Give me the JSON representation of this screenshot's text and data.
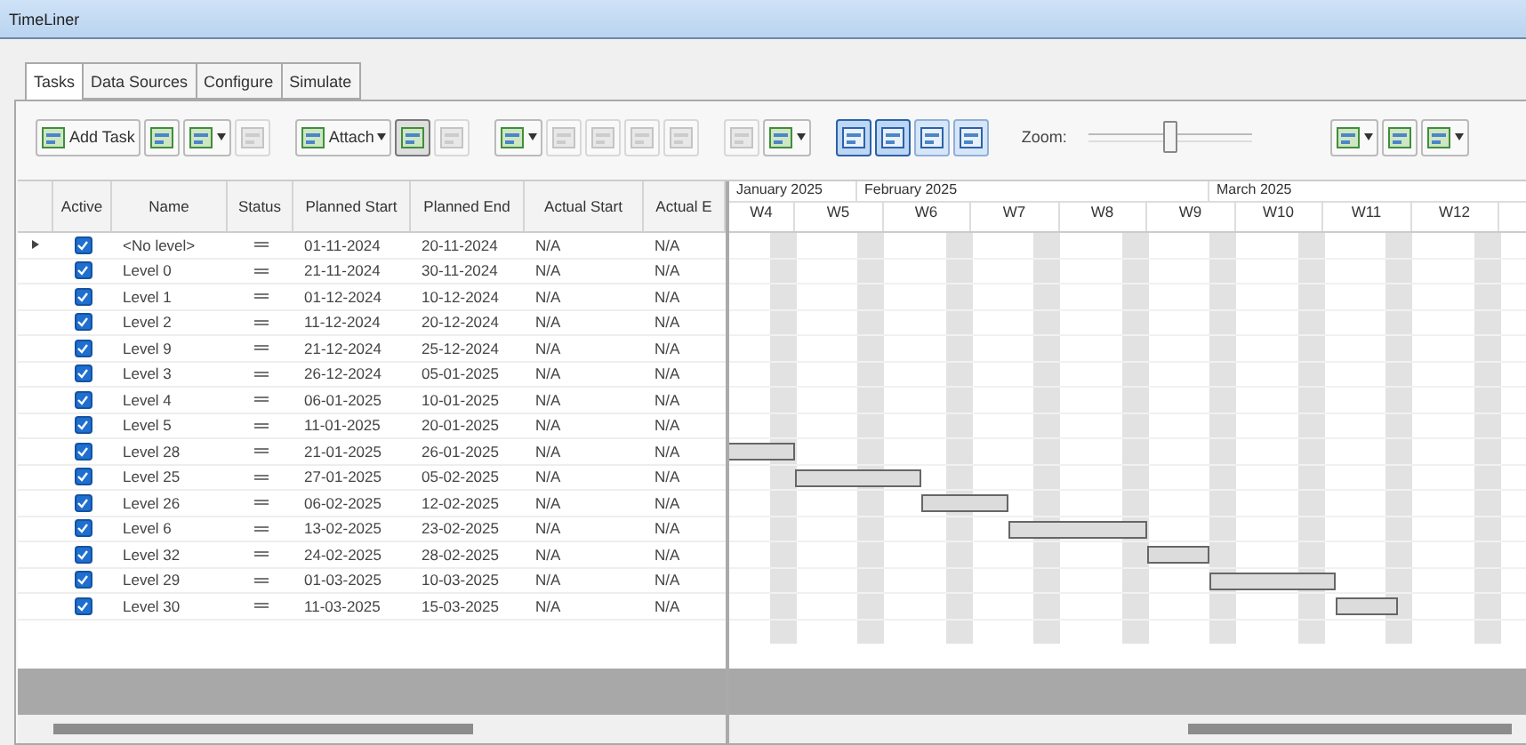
{
  "window": {
    "title": "TimeLiner"
  },
  "tabs": [
    {
      "label": "Tasks",
      "selected": true
    },
    {
      "label": "Data Sources",
      "selected": false
    },
    {
      "label": "Configure",
      "selected": false
    },
    {
      "label": "Simulate",
      "selected": false
    }
  ],
  "toolbar": [
    {
      "kind": "button",
      "label": "Add Task",
      "disabled": false,
      "selected": false
    },
    {
      "kind": "button",
      "disabled": false,
      "selected": false
    },
    {
      "kind": "dropdown",
      "disabled": false,
      "selected": false
    },
    {
      "kind": "button",
      "disabled": true,
      "selected": false
    },
    {
      "kind": "separator"
    },
    {
      "kind": "dropdown",
      "label": "Attach",
      "disabled": false,
      "selected": false
    },
    {
      "kind": "button",
      "disabled": false,
      "selected": true
    },
    {
      "kind": "button",
      "disabled": true,
      "selected": false
    },
    {
      "kind": "separator"
    },
    {
      "kind": "dropdown",
      "disabled": false,
      "selected": false
    },
    {
      "kind": "button",
      "disabled": true,
      "selected": false
    },
    {
      "kind": "button",
      "disabled": true,
      "selected": false
    },
    {
      "kind": "button",
      "disabled": true,
      "selected": false
    },
    {
      "kind": "button",
      "disabled": true,
      "selected": false
    },
    {
      "kind": "separator"
    },
    {
      "kind": "button",
      "disabled": true,
      "selected": false
    },
    {
      "kind": "dropdown",
      "disabled": false,
      "selected": false
    },
    {
      "kind": "separator"
    },
    {
      "kind": "view",
      "disabled": false,
      "selected": true
    },
    {
      "kind": "view",
      "disabled": false,
      "selected": true
    },
    {
      "kind": "view",
      "disabled": false,
      "selected": false
    },
    {
      "kind": "view",
      "disabled": false,
      "selected": false
    }
  ],
  "zoom": {
    "label": "Zoom:",
    "level": 0.5
  },
  "toolbar_right": [
    {
      "kind": "dropdown",
      "disabled": false,
      "selected": false
    },
    {
      "kind": "button",
      "disabled": false,
      "selected": false
    },
    {
      "kind": "dropdown",
      "disabled": false,
      "selected": false
    }
  ],
  "columns": [
    "Active",
    "Name",
    "Status",
    "Planned Start",
    "Planned End",
    "Actual Start",
    "Actual E"
  ],
  "rows": [
    {
      "current": true,
      "active": true,
      "name": "<No level>",
      "planned_start": "01-11-2024",
      "planned_end": "20-11-2024",
      "actual_start": "N/A",
      "actual_end": "N/A"
    },
    {
      "current": false,
      "active": true,
      "name": "Level 0",
      "planned_start": "21-11-2024",
      "planned_end": "30-11-2024",
      "actual_start": "N/A",
      "actual_end": "N/A"
    },
    {
      "current": false,
      "active": true,
      "name": "Level 1",
      "planned_start": "01-12-2024",
      "planned_end": "10-12-2024",
      "actual_start": "N/A",
      "actual_end": "N/A"
    },
    {
      "current": false,
      "active": true,
      "name": "Level 2",
      "planned_start": "11-12-2024",
      "planned_end": "20-12-2024",
      "actual_start": "N/A",
      "actual_end": "N/A"
    },
    {
      "current": false,
      "active": true,
      "name": "Level 9",
      "planned_start": "21-12-2024",
      "planned_end": "25-12-2024",
      "actual_start": "N/A",
      "actual_end": "N/A"
    },
    {
      "current": false,
      "active": true,
      "name": "Level 3",
      "planned_start": "26-12-2024",
      "planned_end": "05-01-2025",
      "actual_start": "N/A",
      "actual_end": "N/A"
    },
    {
      "current": false,
      "active": true,
      "name": "Level 4",
      "planned_start": "06-01-2025",
      "planned_end": "10-01-2025",
      "actual_start": "N/A",
      "actual_end": "N/A"
    },
    {
      "current": false,
      "active": true,
      "name": "Level 5",
      "planned_start": "11-01-2025",
      "planned_end": "20-01-2025",
      "actual_start": "N/A",
      "actual_end": "N/A"
    },
    {
      "current": false,
      "active": true,
      "name": "Level 28",
      "planned_start": "21-01-2025",
      "planned_end": "26-01-2025",
      "actual_start": "N/A",
      "actual_end": "N/A"
    },
    {
      "current": false,
      "active": true,
      "name": "Level 25",
      "planned_start": "27-01-2025",
      "planned_end": "05-02-2025",
      "actual_start": "N/A",
      "actual_end": "N/A"
    },
    {
      "current": false,
      "active": true,
      "name": "Level 26",
      "planned_start": "06-02-2025",
      "planned_end": "12-02-2025",
      "actual_start": "N/A",
      "actual_end": "N/A"
    },
    {
      "current": false,
      "active": true,
      "name": "Level 6",
      "planned_start": "13-02-2025",
      "planned_end": "23-02-2025",
      "actual_start": "N/A",
      "actual_end": "N/A"
    },
    {
      "current": false,
      "active": true,
      "name": "Level 32",
      "planned_start": "24-02-2025",
      "planned_end": "28-02-2025",
      "actual_start": "N/A",
      "actual_end": "N/A"
    },
    {
      "current": false,
      "active": true,
      "name": "Level 29",
      "planned_start": "01-03-2025",
      "planned_end": "10-03-2025",
      "actual_start": "N/A",
      "actual_end": "N/A"
    },
    {
      "current": false,
      "active": true,
      "name": "Level 30",
      "planned_start": "11-03-2025",
      "planned_end": "15-03-2025",
      "actual_start": "N/A",
      "actual_end": "N/A"
    }
  ],
  "gantt": {
    "months": [
      "January 2025",
      "February 2025",
      "March 2025"
    ],
    "weeks": [
      "W4",
      "W5",
      "W6",
      "W7",
      "W8",
      "W9",
      "W10",
      "W11",
      "W12"
    ]
  }
}
